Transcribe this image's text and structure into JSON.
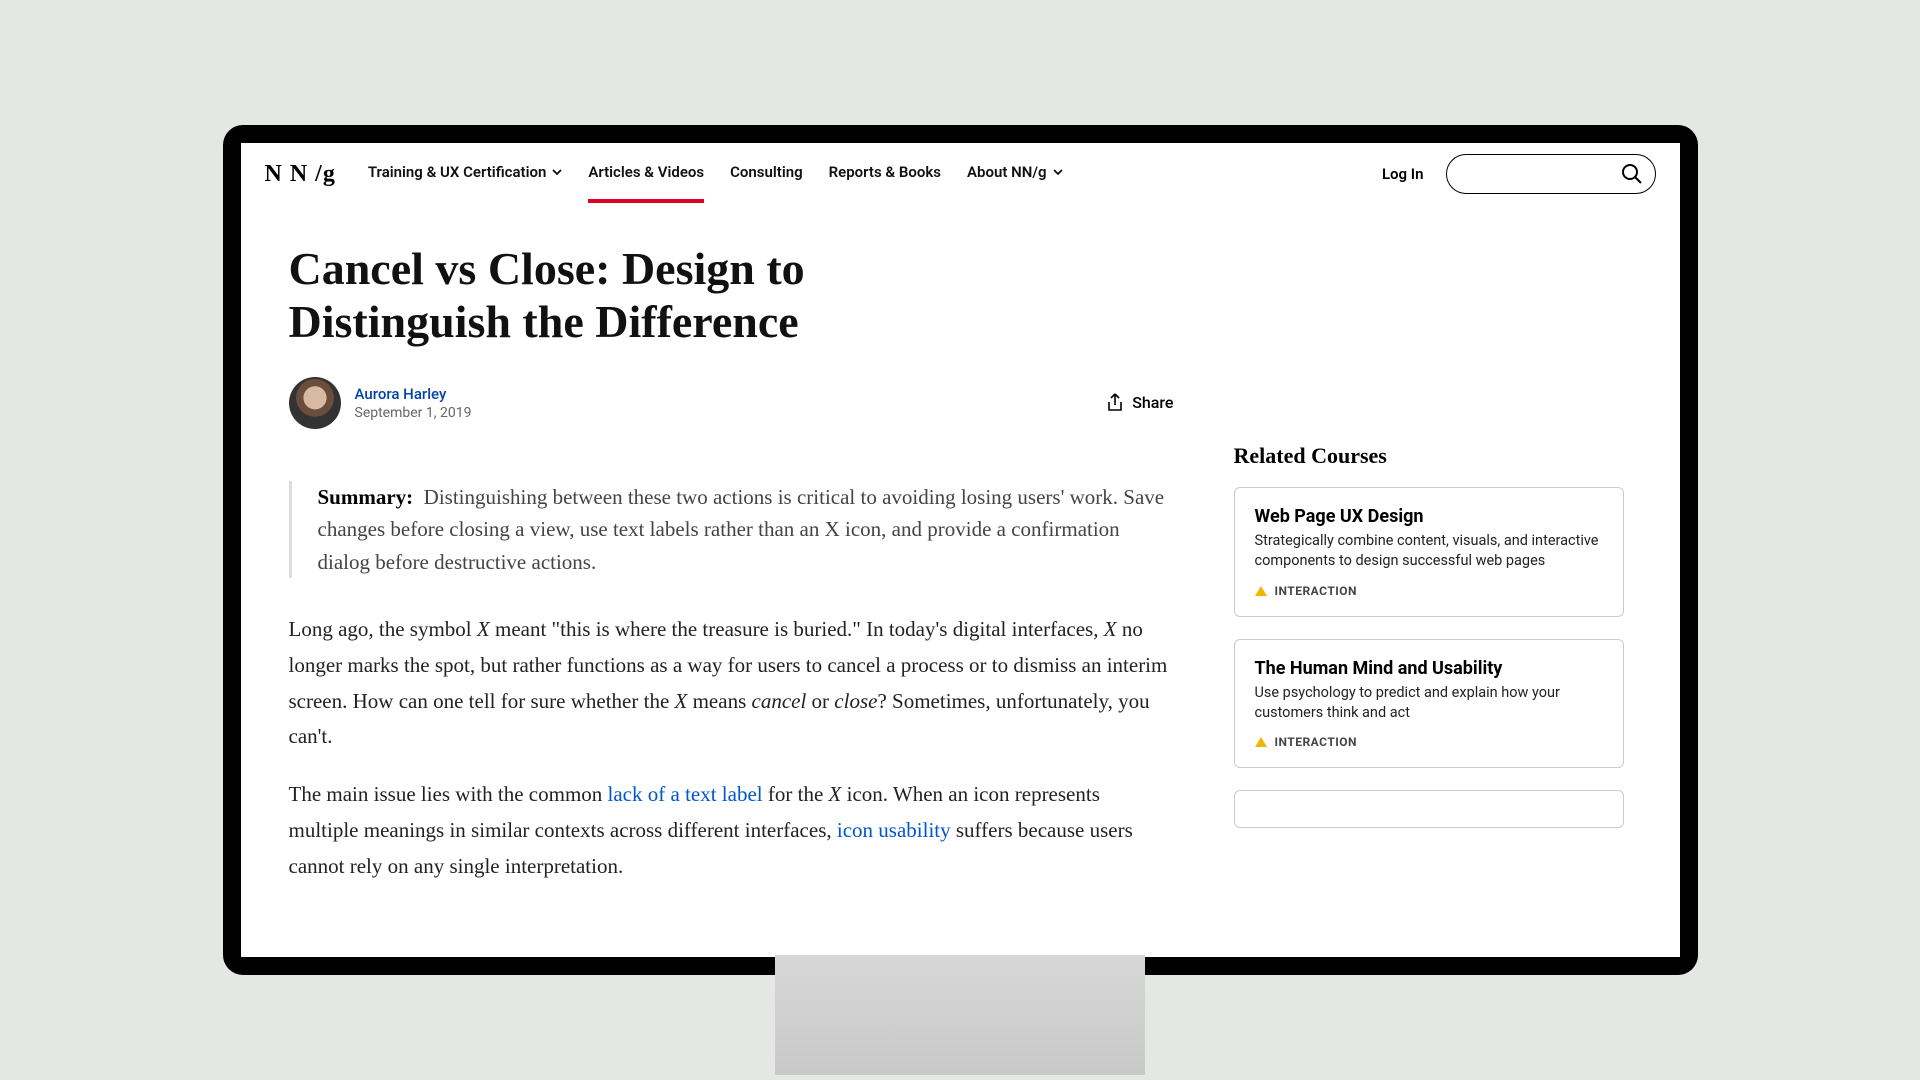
{
  "logo": "N N /g",
  "nav": {
    "items": [
      {
        "label": "Training & UX Certification",
        "chevron": true,
        "active": false
      },
      {
        "label": "Articles & Videos",
        "chevron": false,
        "active": true
      },
      {
        "label": "Consulting",
        "chevron": false,
        "active": false
      },
      {
        "label": "Reports & Books",
        "chevron": false,
        "active": false
      },
      {
        "label": "About NN/g",
        "chevron": true,
        "active": false
      }
    ],
    "login": "Log In"
  },
  "article": {
    "title": "Cancel vs Close: Design to Distinguish the Difference",
    "author": "Aurora Harley",
    "date": "September 1, 2019",
    "share_label": "Share",
    "summary_label": "Summary:",
    "summary_text": "Distinguishing between these two actions is critical to avoiding losing users' work. Save changes before closing a view, use text labels rather than an X icon, and provide a confirmation dialog before destructive actions.",
    "p1_a": "Long ago, the symbol ",
    "p1_x1": "X",
    "p1_b": " meant \"this is where the treasure is buried.\" In today's digital interfaces, ",
    "p1_x2": "X",
    "p1_c": " no longer marks the spot, but rather functions as a way for users to cancel a process or to dismiss an interim screen. How can one tell for sure whether the ",
    "p1_x3": "X",
    "p1_d": " means ",
    "p1_cancel": "cancel",
    "p1_e": " or ",
    "p1_close": "close",
    "p1_f": "? Sometimes, unfortunately, you can't.",
    "p2_a": "The main issue lies with the common ",
    "p2_link1": "lack of a text label",
    "p2_b": " for the ",
    "p2_x": "X",
    "p2_c": " icon. When an icon represents multiple meanings in similar contexts across different interfaces, ",
    "p2_link2": "icon usability",
    "p2_d": " suffers because users cannot rely on any single interpretation."
  },
  "sidebar": {
    "title": "Related Courses",
    "courses": [
      {
        "title": "Web Page UX Design",
        "desc": "Strategically combine content, visuals, and interactive components to design successful web pages",
        "tag": "INTERACTION"
      },
      {
        "title": "The Human Mind and Usability",
        "desc": "Use psychology to predict and explain how your customers think and act",
        "tag": "INTERACTION"
      }
    ]
  }
}
